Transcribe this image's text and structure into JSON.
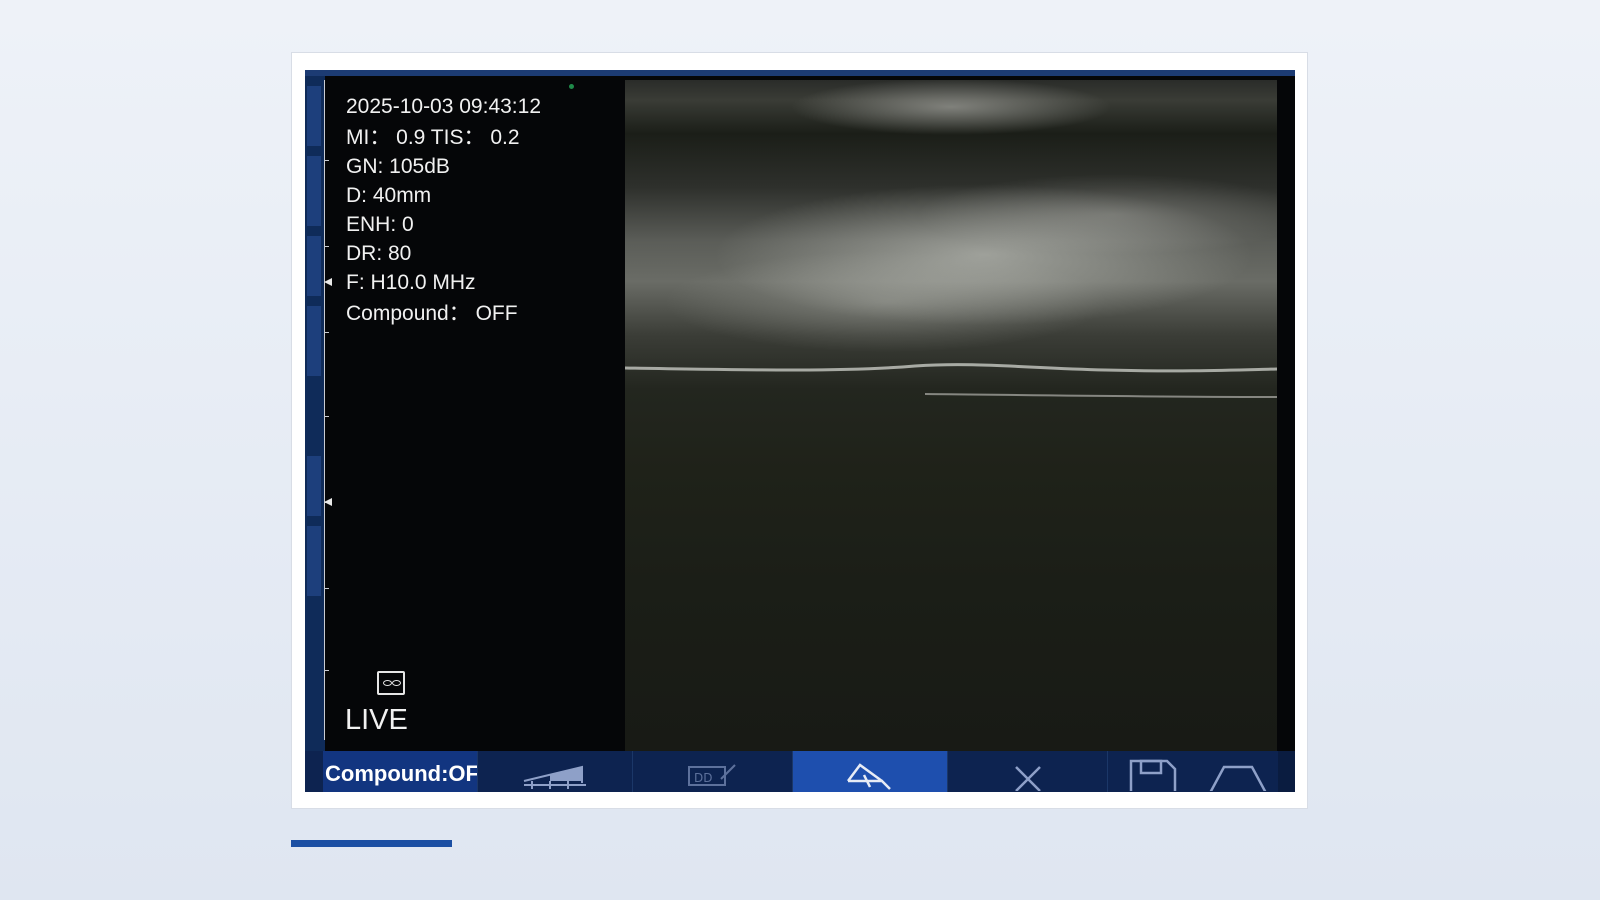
{
  "screen": {
    "timestamp": "2025-10-03 09:43:12",
    "mi_tis": "MI：  0.9  TIS：  0.2",
    "gain": "GN: 105dB",
    "depth": "D: 40mm",
    "enhance": "ENH: 0",
    "dynamic_range": "DR: 80",
    "frequency": "F: H10.0 MHz",
    "compound": "Compound：  OFF",
    "mode_label": "LIVE"
  },
  "toolbar": {
    "compound_label": "Compound:OF",
    "buttons": [
      {
        "icon": "gain-ramp-icon"
      },
      {
        "icon": "annotate-icon"
      },
      {
        "icon": "measure-icon",
        "active": true
      },
      {
        "icon": "close-icon"
      },
      {
        "icon": "save-icon"
      },
      {
        "icon": "probe-shape-icon"
      }
    ]
  },
  "colors": {
    "toolbar_bg": "#0d2350",
    "active_button": "#1e4fae",
    "accent_bar": "#1b4fa3"
  }
}
